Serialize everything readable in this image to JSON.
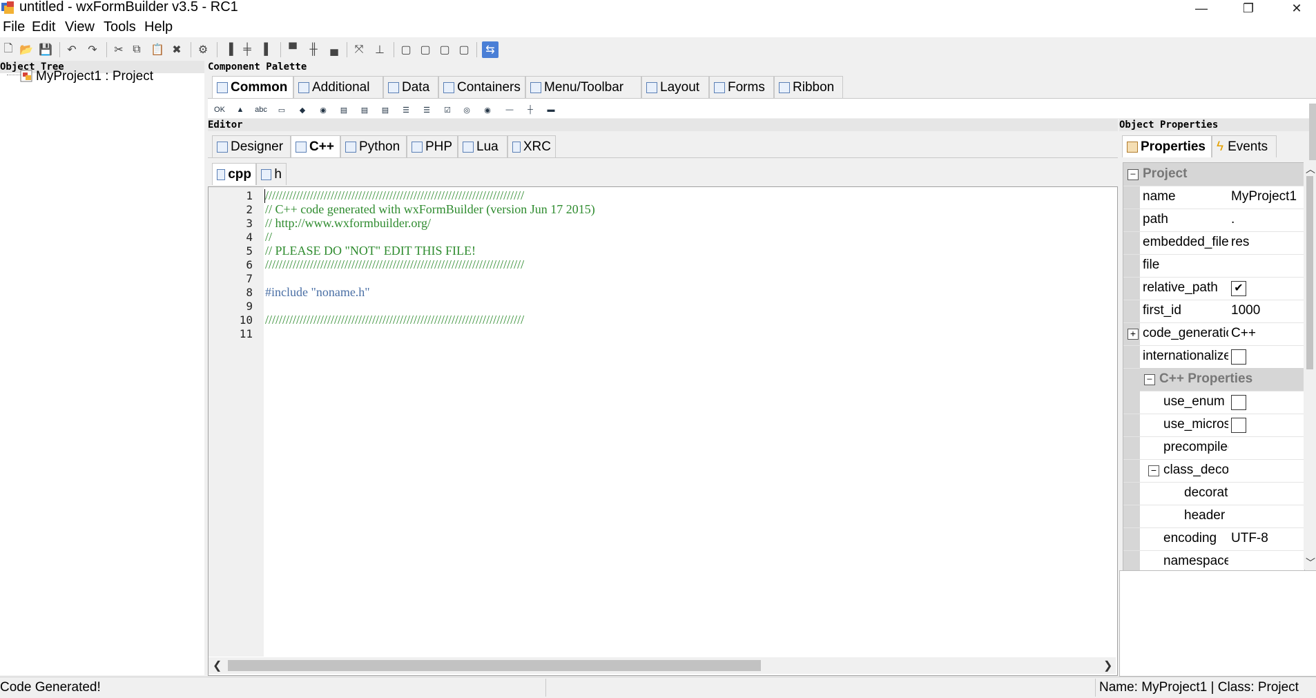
{
  "window": {
    "title": "untitled - wxFormBuilder v3.5 - RC1",
    "minimize": "—",
    "maximize": "❐",
    "close": "✕"
  },
  "menu": {
    "file": "File",
    "edit": "Edit",
    "view": "View",
    "tools": "Tools",
    "help": "Help"
  },
  "object_tree": {
    "header": "Object Tree",
    "root": "MyProject1 : Project"
  },
  "palette": {
    "header": "Component Palette",
    "tabs": [
      "Common",
      "Additional",
      "Data",
      "Containers",
      "Menu/Toolbar",
      "Layout",
      "Forms",
      "Ribbon"
    ],
    "active_tab": "Common"
  },
  "editor": {
    "header": "Editor",
    "tabs": [
      "Designer",
      "C++",
      "Python",
      "PHP",
      "Lua",
      "XRC"
    ],
    "active_tab": "C++",
    "file_tabs": [
      "cpp",
      "h"
    ],
    "line_numbers": [
      "1",
      "2",
      "3",
      "4",
      "5",
      "6",
      "7",
      "8",
      "9",
      "10",
      "11"
    ],
    "lines": [
      "///////////////////////////////////////////////////////////////////////////",
      "// C++ code generated with wxFormBuilder (version Jun 17 2015)",
      "// http://www.wxformbuilder.org/",
      "//",
      "// PLEASE DO \"NOT\" EDIT THIS FILE!",
      "///////////////////////////////////////////////////////////////////////////",
      "",
      "#include \"noname.h\"",
      "",
      "///////////////////////////////////////////////////////////////////////////",
      ""
    ]
  },
  "properties": {
    "header": "Object Properties",
    "tabs": [
      "Properties",
      "Events"
    ],
    "rows": [
      {
        "name": "Project",
        "type": "category"
      },
      {
        "name": "name",
        "value": "MyProject1"
      },
      {
        "name": "path",
        "value": "."
      },
      {
        "name": "embedded_files_path",
        "value": "res"
      },
      {
        "name": "file",
        "value": ""
      },
      {
        "name": "relative_path",
        "value": "",
        "check": "✔"
      },
      {
        "name": "first_id",
        "value": "1000"
      },
      {
        "name": "code_generation",
        "value": "C++"
      },
      {
        "name": "internationalize",
        "value": "",
        "check": ""
      },
      {
        "name": "C++ Properties",
        "type": "category"
      },
      {
        "name": "use_enum",
        "value": "",
        "check": ""
      },
      {
        "name": "use_microsoft_bom",
        "value": "",
        "check": ""
      },
      {
        "name": "precompiled_header",
        "value": ""
      },
      {
        "name": "class_decoration",
        "value": ""
      },
      {
        "name": "decoration",
        "value": ""
      },
      {
        "name": "header",
        "value": ""
      },
      {
        "name": "encoding",
        "value": "UTF-8"
      },
      {
        "name": "namespace",
        "value": ""
      }
    ]
  },
  "status": {
    "left": "Code Generated!",
    "right": "Name: MyProject1 | Class: Project"
  }
}
